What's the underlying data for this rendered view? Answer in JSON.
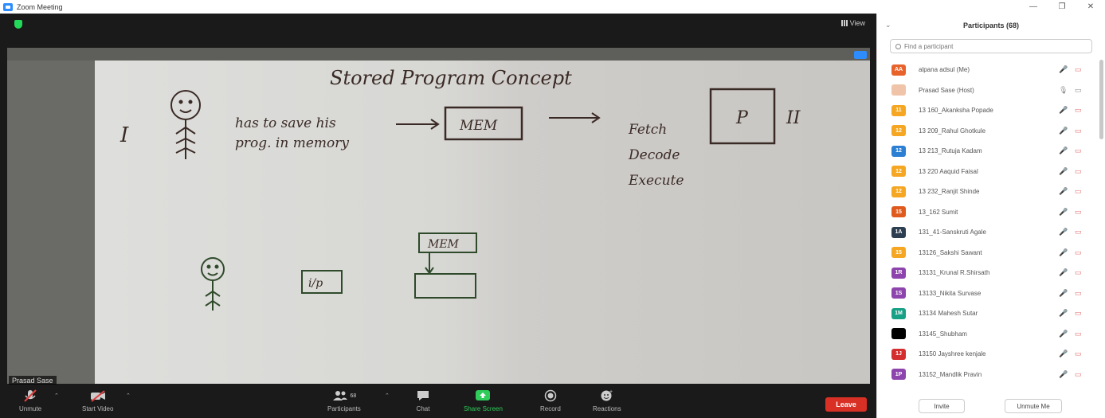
{
  "window": {
    "title": "Zoom Meeting",
    "controls": [
      "—",
      "❐",
      "✕"
    ]
  },
  "meeting": {
    "view_label": "View",
    "speaker_name": "Prasad Sase",
    "whiteboard": {
      "title": "Stored Program Concept",
      "roman_one": "I",
      "roman_two": "II",
      "line1": "has to save his",
      "line2": "prog. in memory",
      "mem_box": "MEM",
      "fetch": "Fetch",
      "decode": "Decode",
      "execute": "Execute",
      "p_box": "P",
      "ip_box": "i/p",
      "mem_box_2": "MEM"
    }
  },
  "toolbar": {
    "unmute": "Unmute",
    "start_video": "Start Video",
    "participants": "Participants",
    "participant_count": "68",
    "chat": "Chat",
    "share_screen": "Share Screen",
    "record": "Record",
    "reactions": "Reactions",
    "leave": "Leave"
  },
  "panel": {
    "title": "Participants (68)",
    "search_placeholder": "Find a participant",
    "invite": "Invite",
    "unmute_me": "Unmute Me",
    "participants": [
      {
        "initials": "AA",
        "name": "alpana adsul (Me)",
        "color": "#e8632b",
        "mic": "muted",
        "cam": "off"
      },
      {
        "initials": "",
        "name": "Prasad Sase (Host)",
        "color": "#f0c4a8",
        "mic": "on",
        "cam": "on"
      },
      {
        "initials": "11",
        "name": "13 160_Akanksha Popade",
        "color": "#f5a623",
        "mic": "muted",
        "cam": "off"
      },
      {
        "initials": "12",
        "name": "13 209_Rahul Ghotkule",
        "color": "#f5a623",
        "mic": "muted",
        "cam": "off"
      },
      {
        "initials": "12",
        "name": "13 213_Rutuja Kadam",
        "color": "#2d7fd3",
        "mic": "muted",
        "cam": "off"
      },
      {
        "initials": "12",
        "name": "13 220 Aaquid Faisal",
        "color": "#f5a623",
        "mic": "muted",
        "cam": "off"
      },
      {
        "initials": "12",
        "name": "13 232_Ranjit Shinde",
        "color": "#f5a623",
        "mic": "muted",
        "cam": "off"
      },
      {
        "initials": "15",
        "name": "13_162 Sumit",
        "color": "#e05a1e",
        "mic": "muted",
        "cam": "off"
      },
      {
        "initials": "1A",
        "name": "131_41-Sanskruti Agale",
        "color": "#2c3e50",
        "mic": "muted",
        "cam": "off"
      },
      {
        "initials": "15",
        "name": "13126_Sakshi Sawant",
        "color": "#f5a623",
        "mic": "muted",
        "cam": "off"
      },
      {
        "initials": "1R",
        "name": "13131_Krunal R.Shirsath",
        "color": "#8e44ad",
        "mic": "muted",
        "cam": "off"
      },
      {
        "initials": "1S",
        "name": "13133_Nikita Survase",
        "color": "#8e44ad",
        "mic": "muted",
        "cam": "off"
      },
      {
        "initials": "1M",
        "name": "13134 Mahesh Sutar",
        "color": "#16a085",
        "mic": "muted",
        "cam": "off"
      },
      {
        "initials": "",
        "name": "13145_Shubham",
        "color": "#000000",
        "mic": "muted",
        "cam": "off"
      },
      {
        "initials": "1J",
        "name": "13150 Jayshree kenjale",
        "color": "#d32f2f",
        "mic": "muted",
        "cam": "off"
      },
      {
        "initials": "1P",
        "name": "13152_Mandlik Pravin",
        "color": "#8e44ad",
        "mic": "muted",
        "cam": "off"
      }
    ]
  }
}
